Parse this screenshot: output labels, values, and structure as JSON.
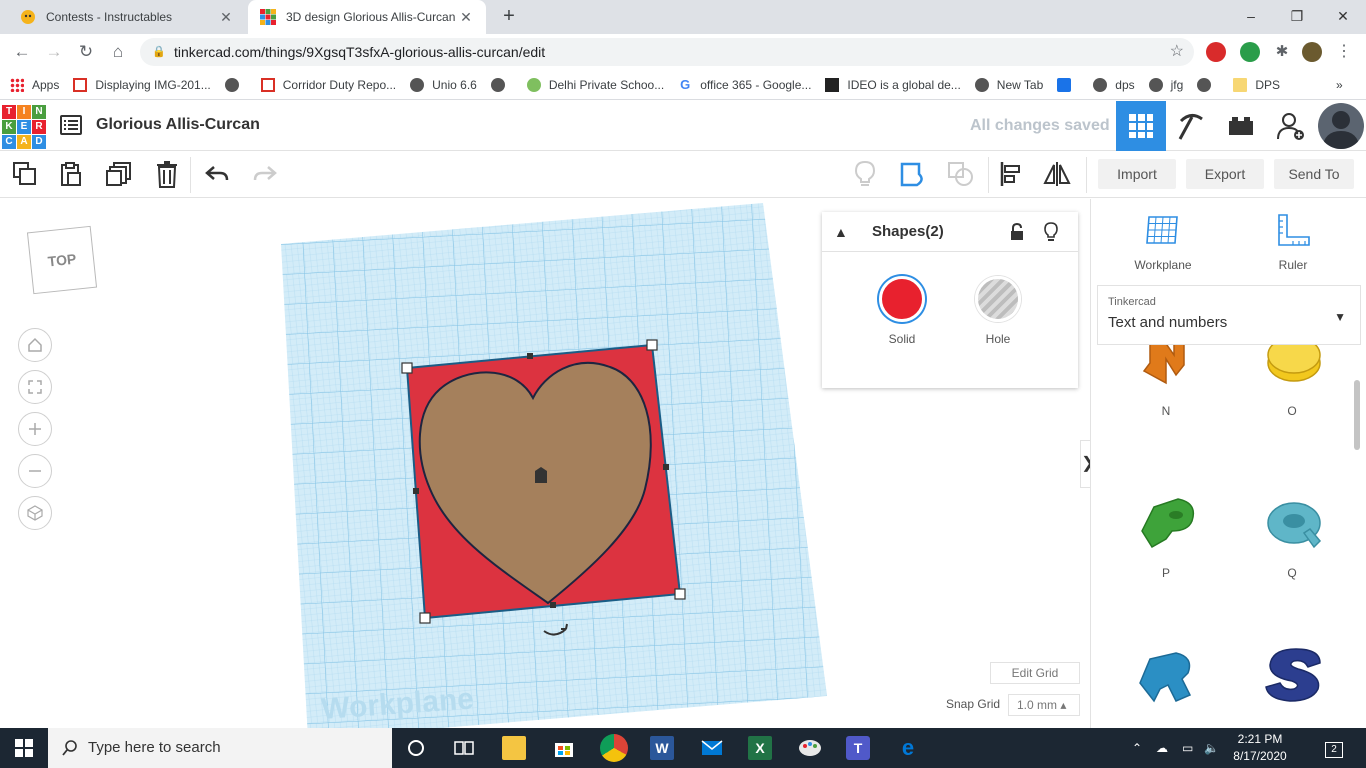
{
  "browser": {
    "tabs": [
      {
        "title": "Contests - Instructables",
        "close": "✕"
      },
      {
        "title": "3D design Glorious Allis-Curcan |",
        "close": "✕"
      }
    ],
    "new_tab": "+",
    "window_controls": {
      "minimize": "–",
      "maximize": "❐",
      "close": "✕"
    },
    "url": "tinkercad.com/things/9XgsqT3sfxA-glorious-allis-curcan/edit",
    "bookmarks": [
      {
        "label": "Apps",
        "icon": "apps-icon"
      },
      {
        "label": "Displaying IMG-201...",
        "icon": "gmail-icon"
      },
      {
        "label": "",
        "icon": "globe-icon"
      },
      {
        "label": "Corridor Duty Repo...",
        "icon": "gmail-icon"
      },
      {
        "label": "Unio 6.6",
        "icon": "globe-icon"
      },
      {
        "label": "",
        "icon": "globe-icon"
      },
      {
        "label": "Delhi Private Schoo...",
        "icon": "school-icon"
      },
      {
        "label": "office 365 - Google...",
        "icon": "google-icon"
      },
      {
        "label": "IDEO is a global de...",
        "icon": "ideo-icon"
      },
      {
        "label": "New Tab",
        "icon": "globe-icon"
      },
      {
        "label": "",
        "icon": "arrow-icon"
      },
      {
        "label": "dps",
        "icon": "globe-icon"
      },
      {
        "label": "jfg",
        "icon": "globe-icon"
      },
      {
        "label": "",
        "icon": "globe-icon"
      },
      {
        "label": "DPS",
        "icon": "folder-icon"
      }
    ],
    "more": "»"
  },
  "app": {
    "logo_letters": [
      "T",
      "I",
      "N",
      "K",
      "E",
      "R",
      "C",
      "A",
      "D"
    ],
    "design_title": "Glorious Allis-Curcan",
    "save_status": "All changes saved"
  },
  "toolbar": {
    "import": "Import",
    "export": "Export",
    "send_to": "Send To"
  },
  "viewport": {
    "viewcube_label": "TOP",
    "workplane_label": "Workplane"
  },
  "shape_panel": {
    "title": "Shapes(2)",
    "solid_label": "Solid",
    "hole_label": "Hole",
    "solid_color": "#e8212e"
  },
  "grid": {
    "edit_grid": "Edit Grid",
    "snap_grid_label": "Snap Grid",
    "snap_grid_value": "1.0 mm ▴"
  },
  "right_panel": {
    "workplane_label": "Workplane",
    "ruler_label": "Ruler",
    "library_source": "Tinkercad",
    "library_category": "Text and numbers",
    "letters": [
      {
        "label": "N",
        "color": "#e07a1a"
      },
      {
        "label": "O",
        "color": "#f2c81e"
      },
      {
        "label": "P",
        "color": "#3ea33a"
      },
      {
        "label": "Q",
        "color": "#5fb6c8"
      },
      {
        "label": "R",
        "color": "#2b8fc4"
      },
      {
        "label": "S",
        "color": "#2c3e8f"
      }
    ]
  },
  "taskbar": {
    "search_placeholder": "Type here to search",
    "time": "2:21 PM",
    "date": "8/17/2020",
    "notifications": "2"
  },
  "colors": {
    "accent": "#2e8ee3",
    "grid_bg": "#cde9f6",
    "grid_line": "#9fd0ea",
    "square": "#dc3340",
    "heart": "#a5805c"
  }
}
